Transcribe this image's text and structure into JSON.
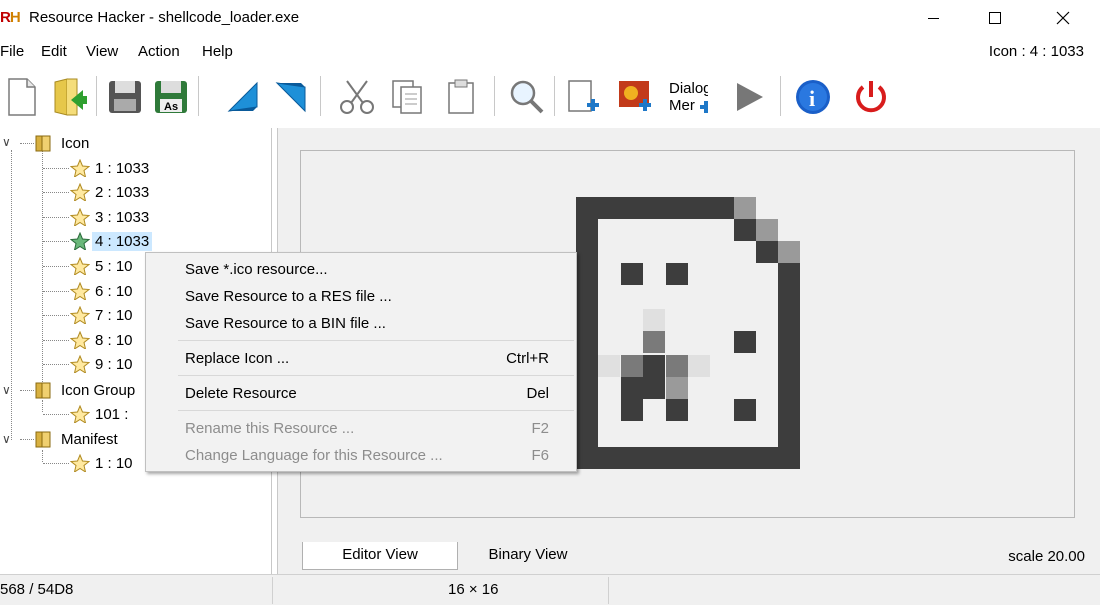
{
  "window": {
    "logo_r": "R",
    "logo_h": "H",
    "title": "Resource Hacker - shellcode_loader.exe",
    "minimize": "─",
    "maximize": "☐",
    "close": "✕"
  },
  "menu": {
    "items": [
      "File",
      "Edit",
      "View",
      "Action",
      "Help"
    ],
    "status_right": "Icon : 4 : 1033"
  },
  "toolbar": {
    "buttons": [
      "new-file",
      "open-file",
      "save",
      "save-as",
      "compile-script",
      "run-script",
      "cut",
      "copy",
      "paste",
      "find",
      "add-blank-resource",
      "add-image-resource",
      "add-dialog-menu",
      "play",
      "info",
      "exit"
    ],
    "dialog_label_1": "Dialog",
    "dialog_label_2": "Mer"
  },
  "tree": {
    "groups": [
      {
        "label": "Icon",
        "expander": "∨"
      },
      {
        "label": "Icon Group",
        "expander": "∨"
      },
      {
        "label": "Manifest",
        "expander": "∨"
      }
    ],
    "icon_items": [
      "1 : 1033",
      "2 : 1033",
      "3 : 1033",
      "4 : 1033",
      "5 : 10",
      "6 : 10",
      "7 : 10",
      "8 : 10",
      "9 : 10"
    ],
    "icon_group_items": [
      "101 :"
    ],
    "manifest_items": [
      "1 : 10"
    ],
    "selected_index": 3
  },
  "context_menu": {
    "items": [
      {
        "label": "Save *.ico resource...",
        "shortcut": "",
        "enabled": true
      },
      {
        "label": "Save Resource to a RES file ...",
        "shortcut": "",
        "enabled": true
      },
      {
        "label": "Save Resource to a BIN file ...",
        "shortcut": "",
        "enabled": true
      },
      {
        "label": "Replace Icon ...",
        "shortcut": "Ctrl+R",
        "enabled": true
      },
      {
        "label": "Delete Resource",
        "shortcut": "Del",
        "enabled": true
      },
      {
        "label": "Rename this Resource ...",
        "shortcut": "F2",
        "enabled": false
      },
      {
        "label": "Change Language for this Resource ...",
        "shortcut": "F6",
        "enabled": false
      }
    ]
  },
  "editor": {
    "tabs": [
      "Editor View",
      "Binary View"
    ],
    "active_tab": 0,
    "scale": "scale 20.00"
  },
  "status": {
    "offset": "568 / 54D8",
    "dimensions": "16 × 16"
  },
  "colors": {
    "selection": "#cce8ff",
    "menu_bg": "#f2f2f2",
    "disabled_text": "#8d8d8d",
    "icon_dark": "#3d3d3d"
  }
}
